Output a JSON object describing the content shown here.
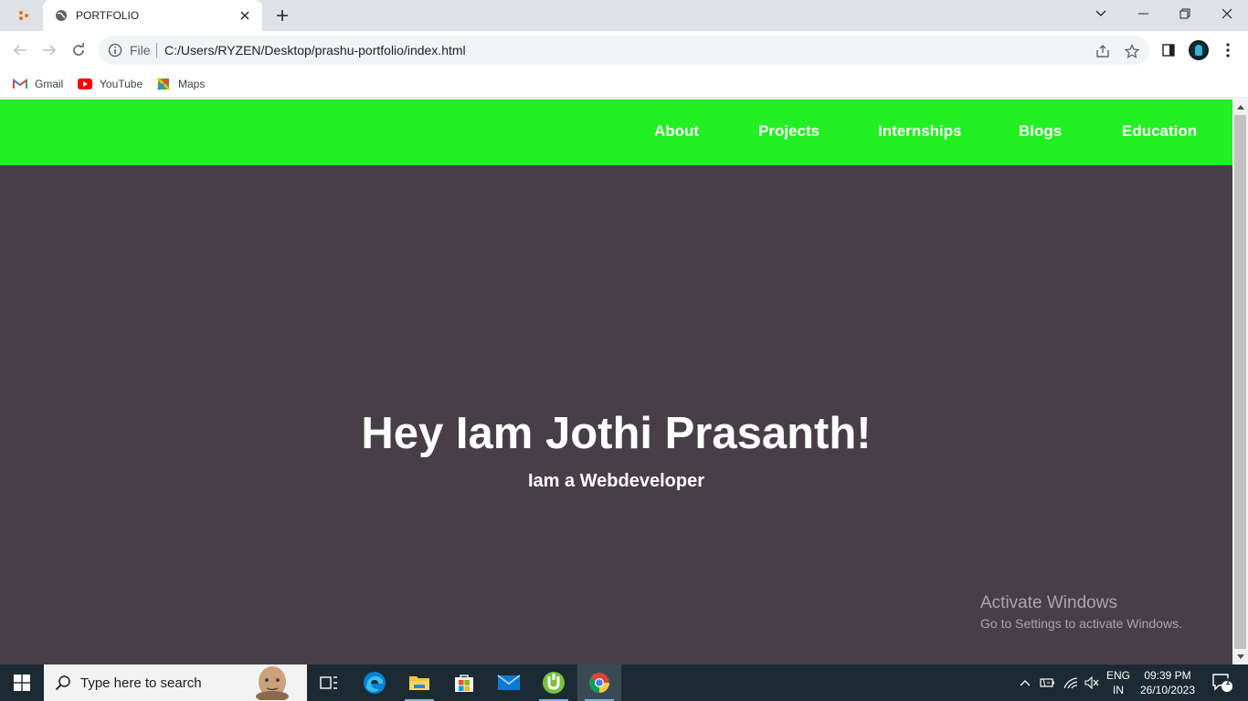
{
  "browser": {
    "tab": {
      "title": "PORTFOLIO"
    },
    "address": {
      "scheme": "File",
      "url": "C:/Users/RYZEN/Desktop/prashu-portfolio/index.html"
    },
    "bookmarks": [
      {
        "label": "Gmail",
        "icon": "gmail-icon"
      },
      {
        "label": "YouTube",
        "icon": "youtube-icon"
      },
      {
        "label": "Maps",
        "icon": "maps-icon"
      }
    ]
  },
  "site": {
    "nav": [
      "About",
      "Projects",
      "Internships",
      "Blogs",
      "Education"
    ],
    "hero": {
      "title": "Hey Iam Jothi Prasanth!",
      "subtitle": "Iam a Webdeveloper"
    },
    "colors": {
      "nav_bg": "#22f022",
      "page_bg": "#483e48",
      "text": "#ffffff"
    }
  },
  "watermark": {
    "line1": "Activate Windows",
    "line2": "Go to Settings to activate Windows."
  },
  "taskbar": {
    "search_placeholder": "Type here to search",
    "language": {
      "code": "ENG",
      "region": "IN"
    },
    "clock": {
      "time": "09:39 PM",
      "date": "26/10/2023"
    },
    "notification_count": "1",
    "apps": [
      "task-view",
      "edge",
      "file-explorer",
      "microsoft-store",
      "mail",
      "utorrent",
      "chrome"
    ]
  }
}
